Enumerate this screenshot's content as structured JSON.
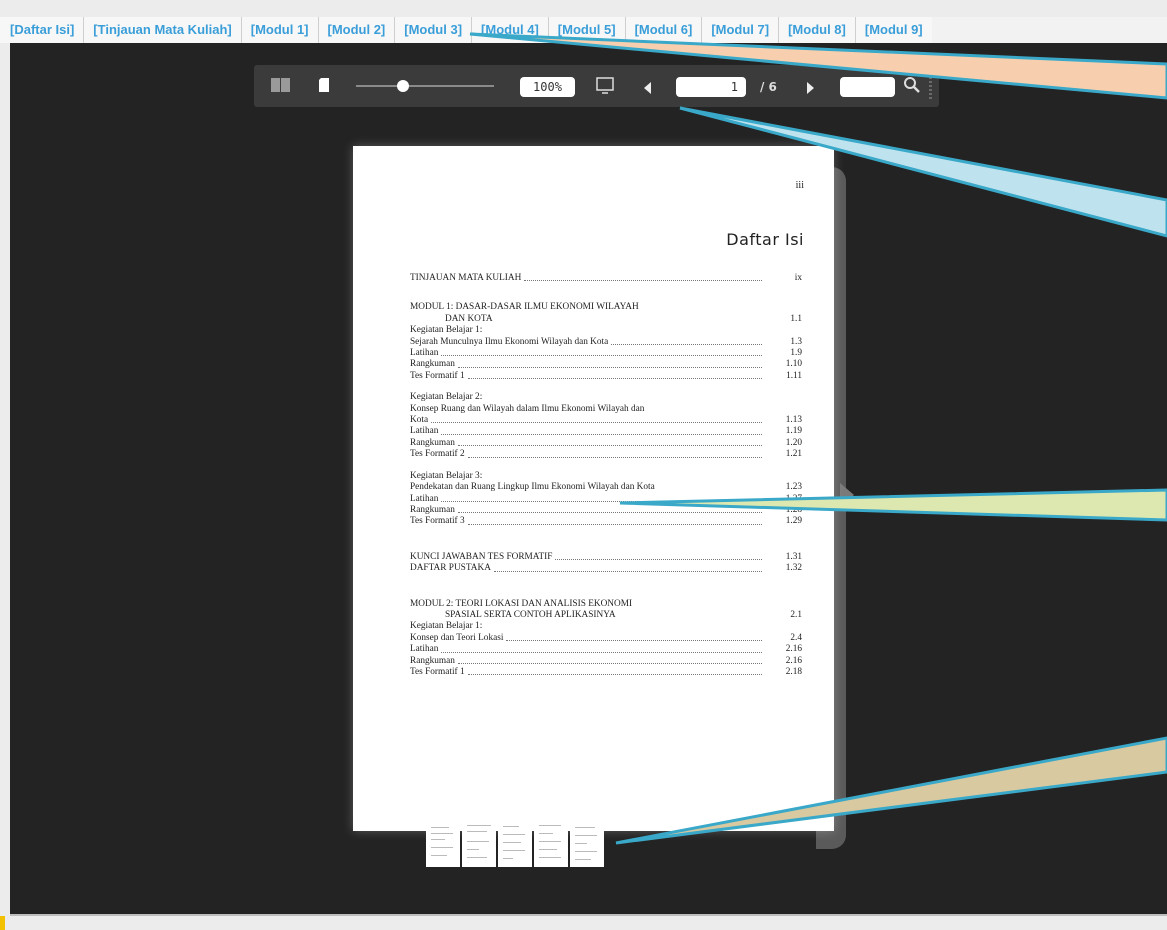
{
  "nav": {
    "tabs": [
      "[Daftar Isi]",
      "[Tinjauan Mata Kuliah]",
      "[Modul 1]",
      "[Modul 2]",
      "[Modul 3]",
      "[Modul 4]",
      "[Modul 5]",
      "[Modul 6]",
      "[Modul 7]",
      "[Modul 8]",
      "[Modul 9]"
    ]
  },
  "toolbar": {
    "zoom": "100%",
    "page_current": "1",
    "page_total": "/ 6",
    "search_value": ""
  },
  "page": {
    "page_number": "iii",
    "title": "Daftar Isi",
    "toc": {
      "tinjauan": {
        "label": "TINJAUAN MATA KULIAH",
        "num": "ix"
      },
      "modul1": {
        "line1": "MODUL 1: DASAR-DASAR ILMU EKONOMI WILAYAH",
        "line2": "DAN KOTA",
        "num": "1.1"
      },
      "kb1": {
        "head": "Kegiatan Belajar 1:",
        "topic": "Sejarah Munculnya Ilmu Ekonomi Wilayah dan Kota",
        "topic_num": "1.3",
        "latihan": "1.9",
        "rangkuman": "1.10",
        "tes_label": "Tes Formatif 1",
        "tes": "1.11"
      },
      "kb2": {
        "head": "Kegiatan Belajar 2:",
        "topic_line1": "Konsep Ruang dan Wilayah dalam Ilmu Ekonomi Wilayah dan",
        "topic_line2": "Kota",
        "topic_num": "1.13",
        "latihan": "1.19",
        "rangkuman": "1.20",
        "tes_label": "Tes Formatif 2",
        "tes": "1.21"
      },
      "kb3": {
        "head": "Kegiatan Belajar 3:",
        "topic": "Pendekatan dan Ruang Lingkup Ilmu Ekonomi Wilayah dan Kota",
        "topic_num": "1.23",
        "latihan": "1.27",
        "rangkuman": "1.28",
        "tes_label": "Tes Formatif 3",
        "tes": "1.29"
      },
      "kunci": {
        "label": "KUNCI JAWABAN TES FORMATIF",
        "num": "1.31"
      },
      "pustaka": {
        "label": "DAFTAR PUSTAKA",
        "num": "1.32"
      },
      "modul2": {
        "line1": "MODUL 2: TEORI LOKASI DAN ANALISIS EKONOMI",
        "line2": "SPASIAL SERTA CONTOH APLIKASINYA",
        "num": "2.1"
      },
      "m2kb1": {
        "head": "Kegiatan Belajar 1:",
        "topic": "Konsep dan Teori Lokasi",
        "topic_num": "2.4",
        "latihan": "2.16",
        "rangkuman": "2.16",
        "tes_label": "Tes Formatif 1",
        "tes": "2.18"
      },
      "latihan_label": "Latihan",
      "rangkuman_label": "Rangkuman"
    }
  },
  "icons": {
    "double_page": "double-page-icon",
    "single_page": "single-page-icon",
    "fullscreen": "fullscreen-icon",
    "prev": "prev-page-icon",
    "next": "next-page-icon",
    "search": "search-icon"
  },
  "colors": {
    "tab_text": "#3a9ed9",
    "viewer_bg": "#232323",
    "callout_blue": "#3aa8c8"
  }
}
